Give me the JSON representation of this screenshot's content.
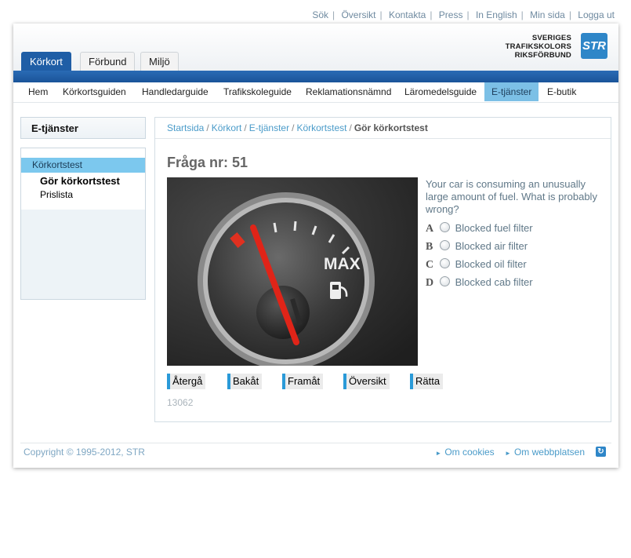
{
  "util_links": [
    "Sök",
    "Översikt",
    "Kontakta",
    "Press",
    "In English",
    "Min sida",
    "Logga ut"
  ],
  "top_tabs": [
    "Körkort",
    "Förbund",
    "Miljö"
  ],
  "logo": {
    "line1": "SVERIGES",
    "line2": "TRAFIKSKOLORS",
    "line3": "RIKSFÖRBUND",
    "badge": "STR"
  },
  "main_nav": [
    "Hem",
    "Körkortsguiden",
    "Handledarguide",
    "Trafikskoleguide",
    "Reklamationsnämnd",
    "Läromedelsguide",
    "E-tjänster",
    "E-butik"
  ],
  "sidebar": {
    "title": "E-tjänster",
    "item": "Körkortstest",
    "sub1": "Gör körkortstest",
    "sub2": "Prislista"
  },
  "breadcrumb": [
    "Startsida",
    "Körkort",
    "E-tjänster",
    "Körkortstest",
    "Gör körkortstest"
  ],
  "question": {
    "title": "Fråga nr: 51",
    "text": "Your car is consuming an unusually large amount of fuel. What is probably wrong?",
    "options": [
      {
        "letter": "A",
        "label": "Blocked fuel filter"
      },
      {
        "letter": "B",
        "label": "Blocked air filter"
      },
      {
        "letter": "C",
        "label": "Blocked oil filter"
      },
      {
        "letter": "D",
        "label": "Blocked cab filter"
      }
    ],
    "gauge_label": "MAX"
  },
  "buttons": [
    "Återgå",
    "Bakåt",
    "Framåt",
    "Översikt",
    "Rätta"
  ],
  "code": "13062",
  "footer": {
    "copyright": "Copyright © 1995-2012, STR",
    "link1": "Om cookies",
    "link2": "Om webbplatsen"
  },
  "colors": {
    "nav_blue": "#1f5ea6",
    "active_light": "#7cc0e6",
    "link": "#4a9bc9"
  }
}
